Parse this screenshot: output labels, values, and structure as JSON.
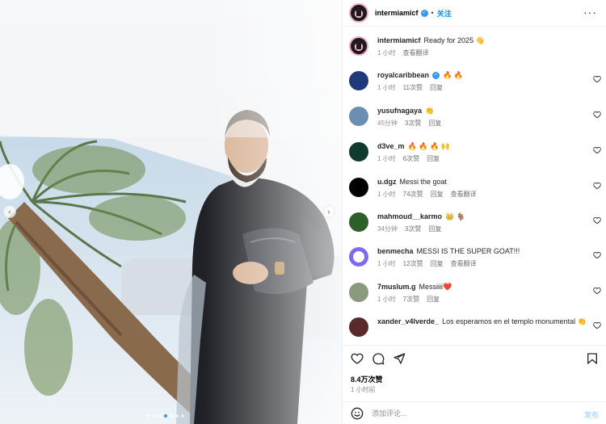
{
  "post": {
    "username": "intermiamicf",
    "follow_label": "关注",
    "dot": "•",
    "more_icon": "more-horizontal-icon",
    "caption": "Ready for 2025 👋",
    "caption_time": "1 小时",
    "caption_translate": "查看翻译",
    "likes": "8.4万次赞",
    "time_ago": "1 小时前",
    "add_comment_placeholder": "添加评论...",
    "post_label": "发布"
  },
  "comments": [
    {
      "user": "royalcaribbean",
      "verified": true,
      "text": "🔥 🔥",
      "time": "1 小时",
      "likes": "11次赞",
      "reply": "回复",
      "translate": ""
    },
    {
      "user": "yusufnagaya",
      "verified": false,
      "text": "👏",
      "time": "45分钟",
      "likes": "3次赞",
      "reply": "回复",
      "translate": ""
    },
    {
      "user": "d3ve_m",
      "verified": false,
      "text": "🔥 🔥 🔥 🙌",
      "time": "1 小时",
      "likes": "6次赞",
      "reply": "回复",
      "translate": ""
    },
    {
      "user": "u.dgz",
      "verified": false,
      "text": "Messi the goat",
      "time": "1 小时",
      "likes": "74次赞",
      "reply": "回复",
      "translate": "查看翻译"
    },
    {
      "user": "mahmoud__karmo",
      "verified": false,
      "text": "👑 🐐",
      "time": "34分钟",
      "likes": "3次赞",
      "reply": "回复",
      "translate": ""
    },
    {
      "user": "benmecha",
      "verified": false,
      "text": "MESSI IS THE SUPER GOAT!!!",
      "time": "1 小时",
      "likes": "12次赞",
      "reply": "回复",
      "translate": "查看翻译"
    },
    {
      "user": "7muslum.g",
      "verified": false,
      "text": "Messiiii❤️",
      "time": "1 小时",
      "likes": "7次赞",
      "reply": "回复",
      "translate": ""
    },
    {
      "user": "xander_v4lverde_",
      "verified": false,
      "text": "Los esperamos en el templo monumental 👏",
      "time": "",
      "likes": "",
      "reply": "",
      "translate": ""
    }
  ],
  "colors": {
    "accent": "#0095f6",
    "verified": "#3897f0",
    "muted": "#8e8e8e"
  },
  "icons": [
    "heart-icon",
    "comment-icon",
    "share-icon",
    "bookmark-icon",
    "emoji-icon",
    "chevron-left-icon",
    "chevron-right-icon"
  ]
}
